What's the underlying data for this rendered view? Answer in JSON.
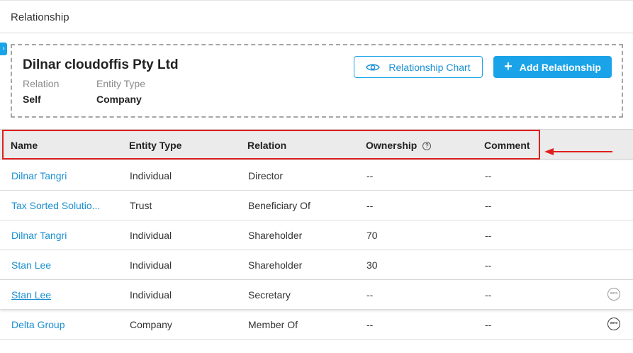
{
  "header": {
    "title": "Relationship"
  },
  "summary": {
    "name": "Dilnar cloudoffis Pty Ltd",
    "relation_label": "Relation",
    "relation_value": "Self",
    "entity_type_label": "Entity Type",
    "entity_type_value": "Company",
    "chart_button": "Relationship Chart",
    "add_button": "Add Relationship",
    "plus": "+"
  },
  "table": {
    "columns": [
      "Name",
      "Entity Type",
      "Relation",
      "Ownership",
      "Comment"
    ],
    "help_icon": "?",
    "rows": [
      {
        "name": "Dilnar Tangri",
        "entity_type": "Individual",
        "relation": "Director",
        "ownership": "--",
        "comment": "--"
      },
      {
        "name": "Tax Sorted Solutio...",
        "entity_type": "Trust",
        "relation": "Beneficiary Of",
        "ownership": "--",
        "comment": "--"
      },
      {
        "name": "Dilnar Tangri",
        "entity_type": "Individual",
        "relation": "Shareholder",
        "ownership": "70",
        "comment": "--"
      },
      {
        "name": "Stan Lee",
        "entity_type": "Individual",
        "relation": "Shareholder",
        "ownership": "30",
        "comment": "--"
      },
      {
        "name": "Stan Lee",
        "entity_type": "Individual",
        "relation": "Secretary",
        "ownership": "--",
        "comment": "--",
        "badge": "xero"
      },
      {
        "name": "Delta Group",
        "entity_type": "Company",
        "relation": "Member Of",
        "ownership": "--",
        "comment": "--",
        "badge": "xero"
      }
    ]
  },
  "colors": {
    "accent": "#1aa3e8",
    "link": "#1a8fd1",
    "highlight": "#e01e1e"
  }
}
